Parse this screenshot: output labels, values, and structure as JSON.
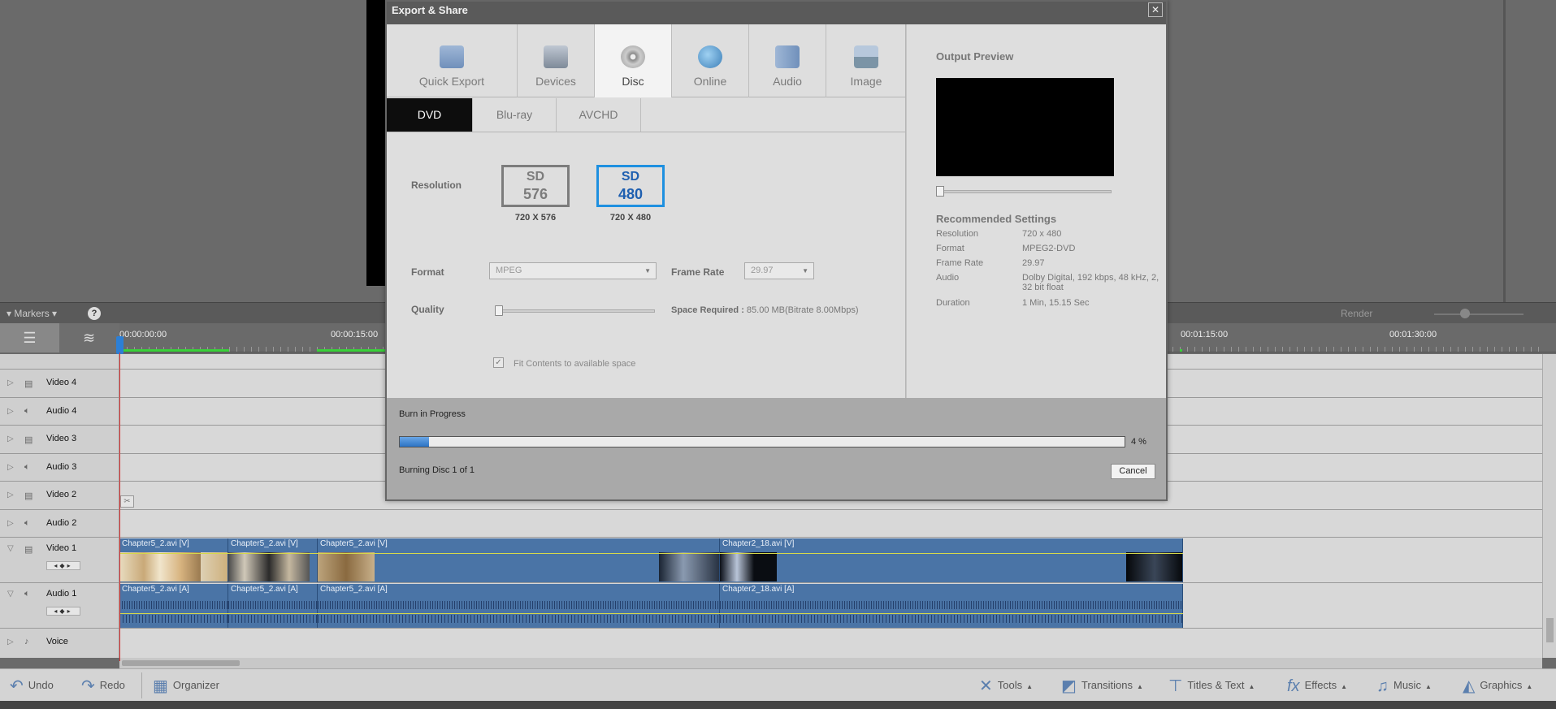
{
  "dialog": {
    "title": "Export & Share",
    "close_glyph": "✕",
    "tabs": [
      {
        "label": "Quick Export",
        "icon": "quick-export-icon"
      },
      {
        "label": "Devices",
        "icon": "devices-icon"
      },
      {
        "label": "Disc",
        "icon": "disc-icon",
        "active": true
      },
      {
        "label": "Online",
        "icon": "globe-icon"
      },
      {
        "label": "Audio",
        "icon": "speaker-icon"
      },
      {
        "label": "Image",
        "icon": "image-icon"
      }
    ],
    "subtabs": [
      {
        "label": "DVD",
        "active": true
      },
      {
        "label": "Blu-ray"
      },
      {
        "label": "AVCHD"
      }
    ],
    "resolution": {
      "label": "Resolution",
      "options": [
        {
          "line1": "SD",
          "line2": "576",
          "caption": "720 X 576",
          "selected": false
        },
        {
          "line1": "SD",
          "line2": "480",
          "caption": "720 X 480",
          "selected": true
        }
      ]
    },
    "format": {
      "label": "Format",
      "value": "MPEG"
    },
    "frame_rate": {
      "label": "Frame Rate",
      "value": "29.97"
    },
    "quality": {
      "label": "Quality",
      "value_fraction": 0.0
    },
    "space_required": {
      "label": "Space Required :",
      "value": "85.00 MB(Bitrate 8.00Mbps)"
    },
    "fit_contents": {
      "label": "Fit Contents to available space",
      "checked": true,
      "glyph": "✓"
    },
    "output_preview": {
      "title": "Output Preview"
    },
    "recommended": {
      "title": "Recommended Settings",
      "rows": [
        {
          "key": "Resolution",
          "value": "720 x 480"
        },
        {
          "key": "Format",
          "value": "MPEG2-DVD"
        },
        {
          "key": "Frame Rate",
          "value": "29.97"
        },
        {
          "key": "Audio",
          "value": "Dolby Digital, 192 kbps, 48 kHz, 2, 32 bit float"
        },
        {
          "key": "Duration",
          "value": "1 Min, 15.15 Sec"
        }
      ]
    },
    "burn": {
      "title": "Burn in Progress",
      "progress_percent": 4,
      "percent_label": "4 %",
      "status": "Burning Disc 1 of 1",
      "cancel_label": "Cancel"
    }
  },
  "timeline": {
    "markers_label": "Markers",
    "help_glyph": "?",
    "render_label": "Render",
    "timecodes": [
      "00:00:00:00",
      "00:00:15:00",
      "00:01:15:00",
      "00:01:30:00"
    ],
    "tracks": [
      {
        "name": "Video 4",
        "kind": "video"
      },
      {
        "name": "Audio 4",
        "kind": "audio"
      },
      {
        "name": "Video 3",
        "kind": "video"
      },
      {
        "name": "Audio 3",
        "kind": "audio"
      },
      {
        "name": "Video 2",
        "kind": "video"
      },
      {
        "name": "Audio 2",
        "kind": "audio"
      },
      {
        "name": "Video 1",
        "kind": "video",
        "expanded": true
      },
      {
        "name": "Audio 1",
        "kind": "audio",
        "expanded": true
      },
      {
        "name": "Voice",
        "kind": "voice"
      }
    ],
    "video_clips": [
      "Chapter5_2.avi [V]",
      "Chapter5_2.avi [V]",
      "Chapter5_2.avi [V]",
      "Chapter2_18.avi [V]"
    ],
    "audio_clips": [
      "Chapter5_2.avi [A]",
      "Chapter5_2.avi [A]",
      "Chapter5_2.avi [A]",
      "Chapter2_18.avi [A]"
    ]
  },
  "toolbar": {
    "undo": "Undo",
    "redo": "Redo",
    "organizer": "Organizer",
    "tools": "Tools",
    "transitions": "Transitions",
    "titles": "Titles & Text",
    "effects": "Effects",
    "music": "Music",
    "graphics": "Graphics"
  },
  "colors": {
    "accent_blue": "#1e90e0",
    "clip_blue": "#4a74a6",
    "playhead_red": "#dd3333",
    "render_green": "#39d139"
  }
}
